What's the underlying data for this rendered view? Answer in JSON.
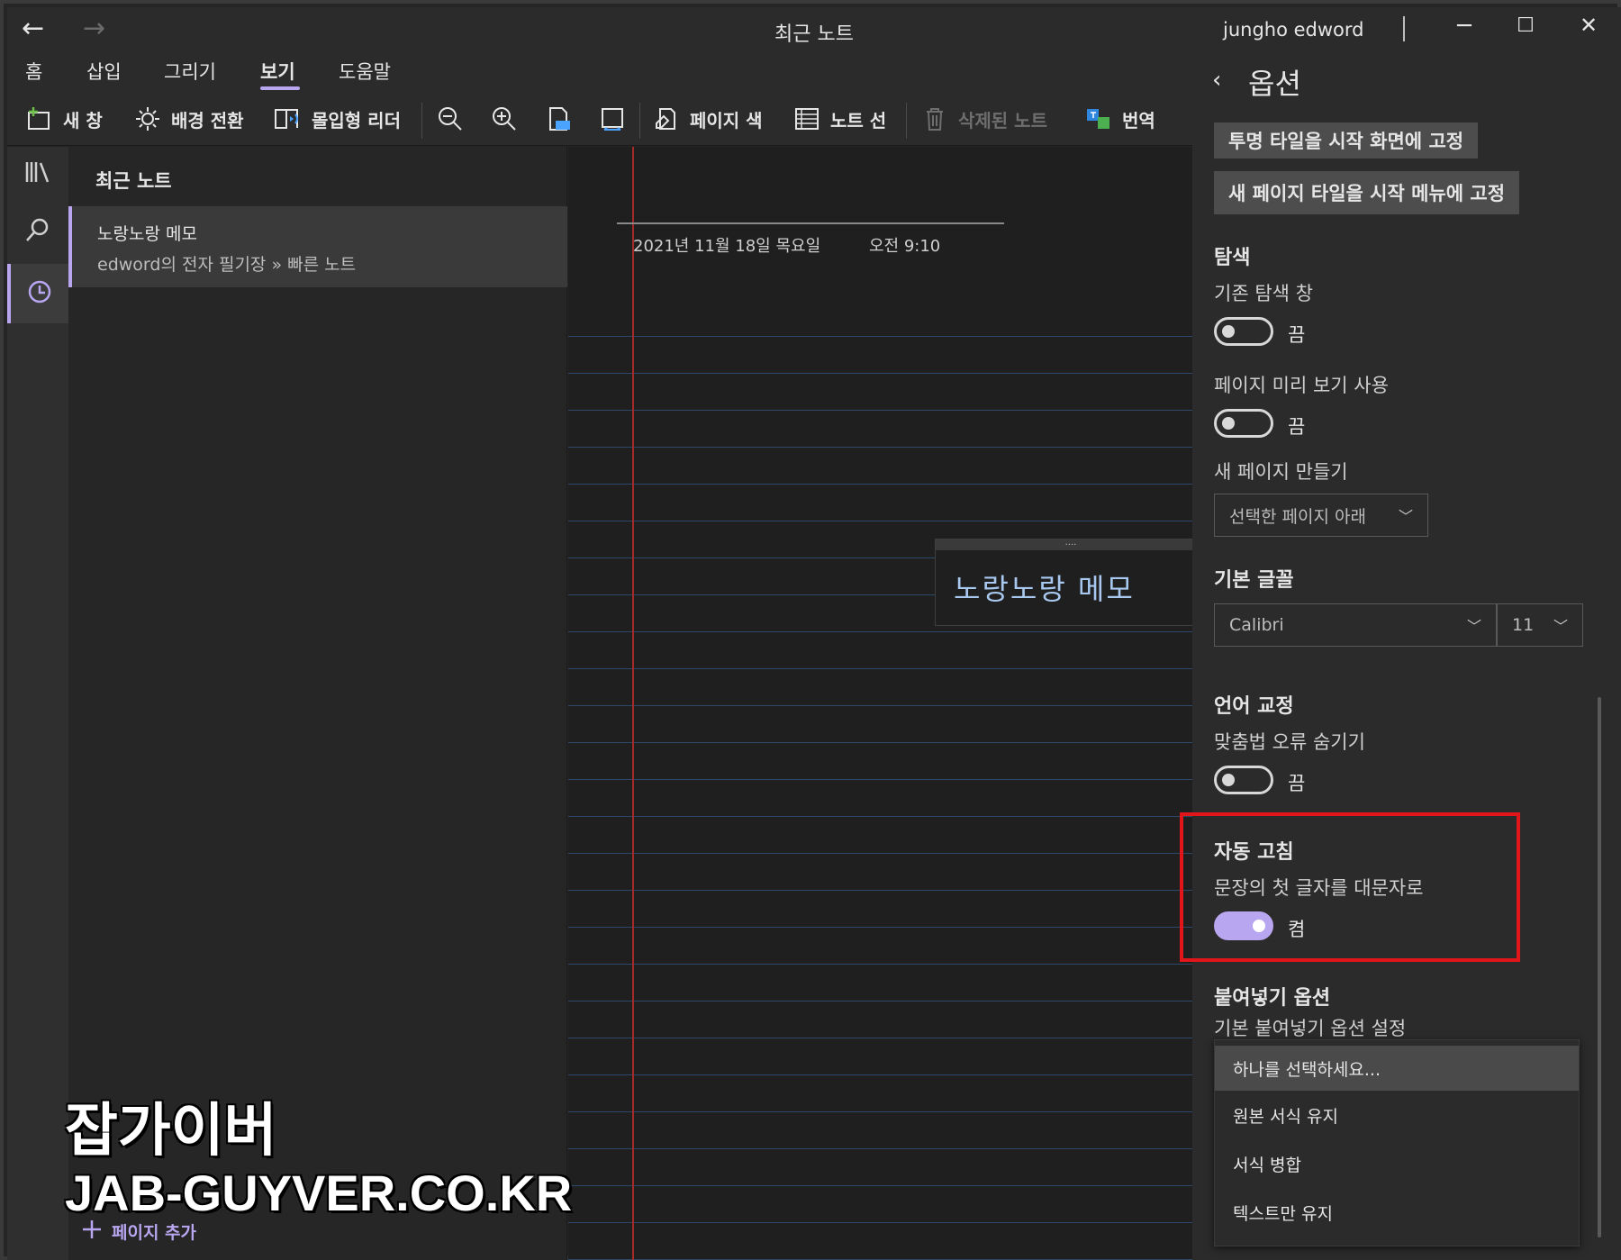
{
  "window": {
    "title": "최근 노트",
    "user": "jungho edword",
    "minimize": "─",
    "maximize": "☐",
    "close": "✕",
    "back": "←",
    "forward": "→"
  },
  "ribbon": {
    "tabs": [
      {
        "label": "홈"
      },
      {
        "label": "삽입"
      },
      {
        "label": "그리기"
      },
      {
        "label": "보기",
        "active": true
      },
      {
        "label": "도움말"
      }
    ],
    "tools": {
      "new_window": "새 창",
      "switch_background": "배경 전환",
      "immersive_reader": "몰입형 리더",
      "page_color": "페이지 색",
      "rule_lines": "노트 선",
      "deleted_notes": "삭제된 노트",
      "translate": "번역"
    }
  },
  "rail": {
    "items": [
      {
        "icon": "notebooks-icon"
      },
      {
        "icon": "search-icon"
      },
      {
        "icon": "recent-clock-icon",
        "active": true
      }
    ]
  },
  "pagelist": {
    "header": "최근 노트",
    "items": [
      {
        "title": "노랑노랑 메모",
        "path": "edword의 전자 필기장 » 빠른 노트"
      }
    ],
    "add_page": "페이지 추가"
  },
  "canvas": {
    "date": "2021년 11월 18일 목요일",
    "time": "오전 9:10",
    "note_text": "노랑노랑 메모",
    "grip": "....",
    "margin_color": "#a52a2a"
  },
  "options": {
    "back": "‹",
    "title": "옵션",
    "pin_transparent_tile": "투명 타일을 시작 화면에 고정",
    "pin_new_page_tile": "새 페이지 타일을 시작 메뉴에 고정",
    "navigation": {
      "heading": "탐색",
      "legacy_nav_label": "기존 탐색 창",
      "legacy_nav_state": "끔",
      "page_preview_label": "페이지 미리 보기 사용",
      "page_preview_state": "끔",
      "new_page_label": "새 페이지 만들기",
      "new_page_value": "선택한 페이지 아래"
    },
    "default_font": {
      "heading": "기본 글꼴",
      "font": "Calibri",
      "size": "11"
    },
    "proofing": {
      "heading": "언어 교정",
      "hide_spelling_label": "맞춤법 오류 숨기기",
      "hide_spelling_state": "끔"
    },
    "autocorrect": {
      "heading": "자동 고침",
      "capitalize_label": "문장의 첫 글자를 대문자로",
      "capitalize_state": "켬"
    },
    "paste": {
      "heading": "붙여넣기 옵션",
      "default_label": "기본 붙여넣기 옵션 설정",
      "options": [
        {
          "label": "하나를 선택하세요...",
          "selected": true
        },
        {
          "label": "원본 서식 유지"
        },
        {
          "label": "서식 병합"
        },
        {
          "label": "텍스트만 유지"
        }
      ]
    },
    "accent_color": "#b9a6f0",
    "highlight_color": "#e0161b"
  },
  "watermark": {
    "line1": "잡가이버",
    "line2": "JAB-GUYVER.CO.KR"
  }
}
